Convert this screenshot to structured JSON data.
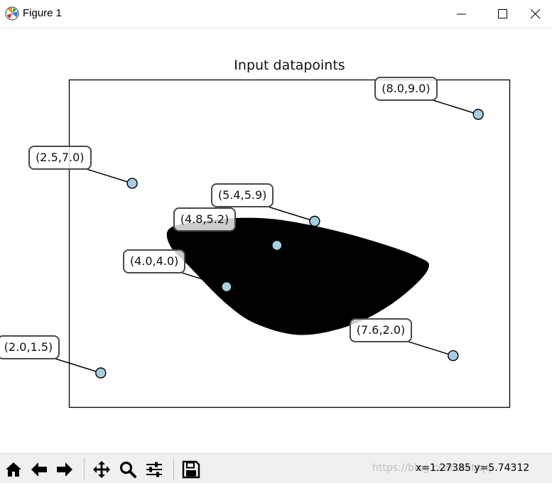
{
  "window": {
    "title": "Figure 1"
  },
  "figure": {
    "title": "Input datapoints"
  },
  "chart_data": {
    "type": "scatter",
    "title": "Input datapoints",
    "xlim": [
      1.5,
      8.5
    ],
    "ylim": [
      0.5,
      10.0
    ],
    "xlabel": "",
    "ylabel": "",
    "grid": false,
    "axis_ticks": false,
    "marker_color": "#a6cee3",
    "points": [
      {
        "x": 2.0,
        "y": 1.5,
        "label": "(2.0,1.5)"
      },
      {
        "x": 2.5,
        "y": 7.0,
        "label": "(2.5,7.0)"
      },
      {
        "x": 4.0,
        "y": 4.0,
        "label": "(4.0,4.0)"
      },
      {
        "x": 4.8,
        "y": 5.2,
        "label": "(4.8,5.2)"
      },
      {
        "x": 5.4,
        "y": 5.9,
        "label": "(5.4,5.9)"
      },
      {
        "x": 7.6,
        "y": 2.0,
        "label": "(7.6,2.0)"
      },
      {
        "x": 8.0,
        "y": 9.0,
        "label": "(8.0,9.0)"
      }
    ],
    "region_color": "#000000"
  },
  "toolbar": {
    "coords_text": "x=1.27385    y=5.74312",
    "watermark": "https://blog.csdn.net/qq"
  }
}
